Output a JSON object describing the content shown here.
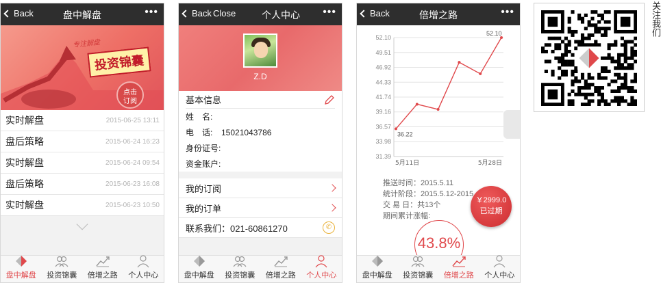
{
  "colors": {
    "accent": "#e0484b",
    "topbar": "#2e2e2e",
    "banner": "#ee6f66"
  },
  "tabs": [
    {
      "label": "盘中解盘",
      "icon": "diamond-icon"
    },
    {
      "label": "投资锦囊",
      "icon": "group-icon"
    },
    {
      "label": "倍增之路",
      "icon": "trend-chart-icon"
    },
    {
      "label": "个人中心",
      "icon": "person-icon"
    }
  ],
  "screen1": {
    "back": "Back",
    "title": "盘中解盘",
    "banner": {
      "slogan": "专注解盘",
      "headline": "投资锦囊",
      "subscribe_line1": "点击",
      "subscribe_line2": "订阅"
    },
    "items": [
      {
        "label": "实时解盘",
        "date": "2015-06-25 13:11"
      },
      {
        "label": "盘后策略",
        "date": "2015-06-24 16:23"
      },
      {
        "label": "实时解盘",
        "date": "2015-06-24 09:54"
      },
      {
        "label": "盘后策略",
        "date": "2015-06-23 16:08"
      },
      {
        "label": "实时解盘",
        "date": "2015-06-23 10:50"
      }
    ],
    "active_tab": 0
  },
  "screen2": {
    "back": "Back",
    "close": "Close",
    "title": "个人中心",
    "username": "Z.D",
    "basic_info": "基本信息",
    "fields": [
      {
        "key": "姓　名:",
        "value": ""
      },
      {
        "key": "电　话:",
        "value": "15021043786"
      },
      {
        "key": "身份证号:",
        "value": ""
      },
      {
        "key": "资金账户:",
        "value": ""
      }
    ],
    "menu": {
      "subscriptions": "我的订阅",
      "orders": "我的订单",
      "contact": "联系我们：021-60861270"
    },
    "active_tab": 3
  },
  "screen3": {
    "back": "Back",
    "title": "倍增之路",
    "stats": {
      "push_time": "推送时间：2015.5.11",
      "period": "统计阶段：2015.5.12-2015",
      "trade_days": "交 易 日：共13个",
      "gain_label": "期间累计涨幅:"
    },
    "price": "￥2999.0",
    "price_status": "已过期",
    "gain": "43.8%",
    "active_tab": 2
  },
  "chart_data": {
    "type": "line",
    "x_start_label": "5月11日",
    "x_end_label": "5月28日",
    "y_ticks": [
      "52.10",
      "49.51",
      "46.92",
      "44.33",
      "41.74",
      "39.16",
      "36.57",
      "33.98",
      "31.39"
    ],
    "ylim": [
      31.39,
      52.1
    ],
    "values": [
      36.22,
      40.5,
      39.6,
      47.8,
      45.8,
      52.1
    ],
    "first_label": "36.22",
    "last_label": "52.10"
  },
  "qr": {
    "side_text": "关注我们"
  }
}
